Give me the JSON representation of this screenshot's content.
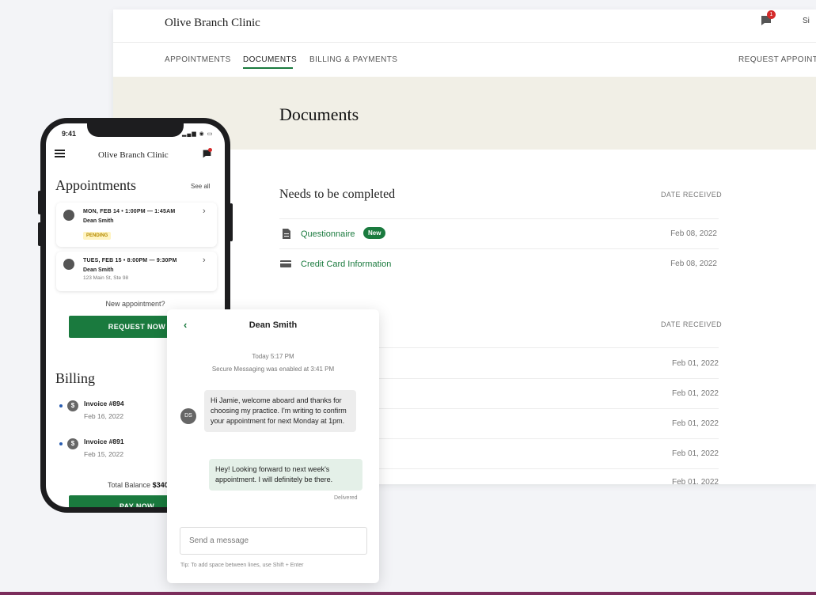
{
  "desktop": {
    "brand": "Olive Branch Clinic",
    "notification_count": "1",
    "signin_label": "Si",
    "nav": [
      "APPOINTMENTS",
      "DOCUMENTS",
      "BILLING & PAYMENTS"
    ],
    "nav_active": "DOCUMENTS",
    "request_label": "REQUEST APPOINT",
    "page_title": "Documents",
    "needs_section": {
      "title": "Needs to be completed",
      "date_header": "DATE RECEIVED",
      "items": [
        {
          "name": "Questionnaire",
          "badge": "New",
          "date": "Feb 08, 2022",
          "icon": "document-icon"
        },
        {
          "name": "Credit Card Information",
          "date": "Feb 08, 2022",
          "icon": "credit-card-icon"
        }
      ]
    },
    "second_section": {
      "date_header": "DATE RECEIVED",
      "dates": [
        "Feb 01, 2022",
        "Feb 01, 2022",
        "Feb 01, 2022",
        "Feb 01, 2022",
        "Feb 01, 2022"
      ]
    }
  },
  "phone": {
    "time": "9:41",
    "status_icons": "signal-wifi-battery",
    "brand": "Olive Branch Clinic",
    "appointments_title": "Appointments",
    "see_all": "See all",
    "appointments": [
      {
        "datetime": "MON, FEB 14 • 1:00PM — 1:45AM",
        "name": "Dean Smith",
        "status": "PENDING",
        "icon": "video-icon"
      },
      {
        "datetime": "TUES, FEB 15 • 8:00PM — 9:30PM",
        "name": "Dean Smith",
        "address": "123 Main St, Ste 98",
        "icon": "location-icon"
      }
    ],
    "new_appointment": "New appointment?",
    "request_now": "REQUEST NOW",
    "billing_title": "Billing",
    "invoices": [
      {
        "name": "Invoice #894",
        "date": "Feb 16, 2022"
      },
      {
        "name": "Invoice #891",
        "date": "Feb 15, 2022"
      }
    ],
    "total_label": "Total Balance",
    "total_value": "$340",
    "pay_now": "PAY NOW"
  },
  "chat": {
    "contact": "Dean Smith",
    "timestamp": "Today 5:17 PM",
    "system_note": "Secure Messaging was enabled at 3:41 PM",
    "avatar_initials": "DS",
    "incoming": "Hi Jamie, welcome aboard and thanks for choosing my practice. I'm writing to confirm your appointment for next Monday at 1pm.",
    "outgoing": "Hey! Looking forward to next week's appointment. I will definitely be there.",
    "delivered": "Delivered",
    "input_placeholder": "Send a message",
    "tip": "Tip: To add space between lines, use Shift + Enter"
  },
  "colors": {
    "accent_green": "#1a7a3e",
    "badge_red": "#d42b2b",
    "banner": "#f1efe6"
  }
}
